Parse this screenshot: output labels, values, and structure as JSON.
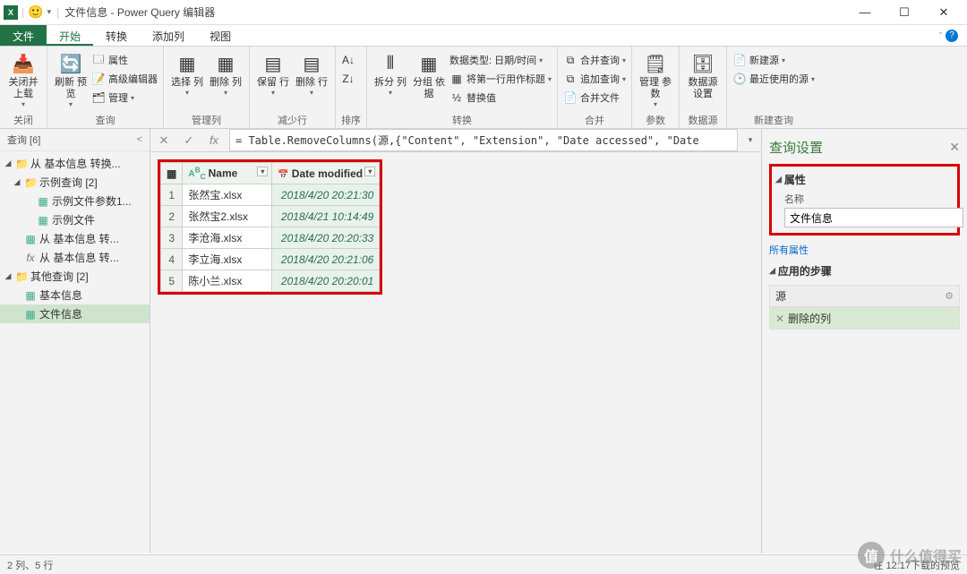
{
  "title": "文件信息 - Power Query 编辑器",
  "tabs": {
    "file": "文件",
    "home": "开始",
    "transform": "转换",
    "addcol": "添加列",
    "view": "视图"
  },
  "ribbon": {
    "close": {
      "closeLoad": "关闭并\n上载",
      "group": "关闭"
    },
    "query": {
      "refresh": "刷新\n预览",
      "props": "属性",
      "advEd": "高级编辑器",
      "manage": "管理",
      "group": "查询"
    },
    "cols": {
      "choose": "选择\n列",
      "remove": "删除\n列",
      "group": "管理列"
    },
    "rows": {
      "keep": "保留\n行",
      "remove": "删除\n行",
      "group": "减少行"
    },
    "sort": {
      "group": "排序"
    },
    "split": {
      "split": "拆分\n列",
      "groupby": "分组\n依据",
      "group": "转换"
    },
    "trans": {
      "dtype": "数据类型: 日期/时间",
      "header": "将第一行用作标题",
      "replace": "替换值"
    },
    "combine": {
      "merge": "合并查询",
      "append": "追加查询",
      "combine": "合并文件",
      "group": "合并"
    },
    "params": {
      "manage": "管理\n参数",
      "group": "参数"
    },
    "ds": {
      "settings": "数据源\n设置",
      "group": "数据源"
    },
    "new": {
      "new": "新建源",
      "recent": "最近使用的源",
      "group": "新建查询"
    }
  },
  "nav": {
    "header": "查询 [6]",
    "items": [
      {
        "type": "folder",
        "label": "从 基本信息 转换...",
        "level": 0,
        "exp": true
      },
      {
        "type": "folder",
        "label": "示例查询 [2]",
        "level": 1,
        "exp": true
      },
      {
        "type": "table",
        "label": "示例文件参数1...",
        "level": 2
      },
      {
        "type": "table",
        "label": "示例文件",
        "level": 2
      },
      {
        "type": "table",
        "label": "从 基本信息 转...",
        "level": 1
      },
      {
        "type": "fx",
        "label": "从 基本信息 转...",
        "level": 1
      },
      {
        "type": "folder",
        "label": "其他查询 [2]",
        "level": 0,
        "exp": true
      },
      {
        "type": "table",
        "label": "基本信息",
        "level": 1
      },
      {
        "type": "table",
        "label": "文件信息",
        "level": 1,
        "sel": true
      }
    ]
  },
  "formula": "= Table.RemoveColumns(源,{\"Content\", \"Extension\", \"Date accessed\", \"Date",
  "grid": {
    "cols": [
      {
        "name": "Name",
        "type": "ABC"
      },
      {
        "name": "Date modified",
        "type": "date"
      }
    ],
    "rows": [
      {
        "n": "1",
        "name": "张然宝.xlsx",
        "date": "2018/4/20 20:21:30"
      },
      {
        "n": "2",
        "name": "张然宝2.xlsx",
        "date": "2018/4/21 10:14:49"
      },
      {
        "n": "3",
        "name": "李沧海.xlsx",
        "date": "2018/4/20 20:20:33"
      },
      {
        "n": "4",
        "name": "李立海.xlsx",
        "date": "2018/4/20 20:21:06"
      },
      {
        "n": "5",
        "name": "陈小兰.xlsx",
        "date": "2018/4/20 20:20:01"
      }
    ]
  },
  "qpanel": {
    "title": "查询设置",
    "propsTitle": "属性",
    "nameLabel": "名称",
    "nameValue": "文件信息",
    "allProps": "所有属性",
    "stepsTitle": "应用的步骤",
    "steps": [
      {
        "label": "源",
        "active": false,
        "gear": true
      },
      {
        "label": "删除的列",
        "active": true,
        "del": true
      }
    ]
  },
  "status": {
    "left": "2 列、5 行",
    "right": "在 12:17下载的预览"
  },
  "watermark": "什么值得买"
}
